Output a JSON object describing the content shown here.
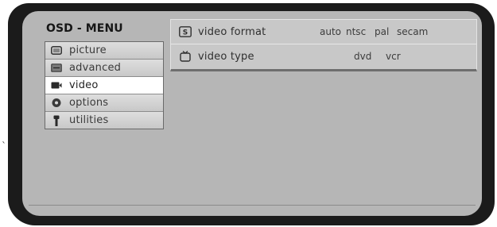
{
  "stray_mark": "`",
  "osd": {
    "title": "OSD - MENU",
    "menu": [
      {
        "label": "picture",
        "icon": "picture-icon"
      },
      {
        "label": "advanced",
        "icon": "advanced-icon"
      },
      {
        "label": "video",
        "icon": "video-icon",
        "active": true
      },
      {
        "label": "options",
        "icon": "options-icon"
      },
      {
        "label": "utilities",
        "icon": "utilities-icon"
      }
    ],
    "settings": [
      {
        "label": "video format",
        "icon": "video-format-icon",
        "options": [
          "auto",
          "ntsc",
          "pal",
          "secam"
        ]
      },
      {
        "label": "video type",
        "icon": "video-type-icon",
        "options": [
          "dvd",
          "vcr"
        ]
      }
    ],
    "colors": {
      "screen": "#b6b6b6",
      "bezel": "#1b1b1b",
      "active_item": "#ffffff"
    }
  }
}
